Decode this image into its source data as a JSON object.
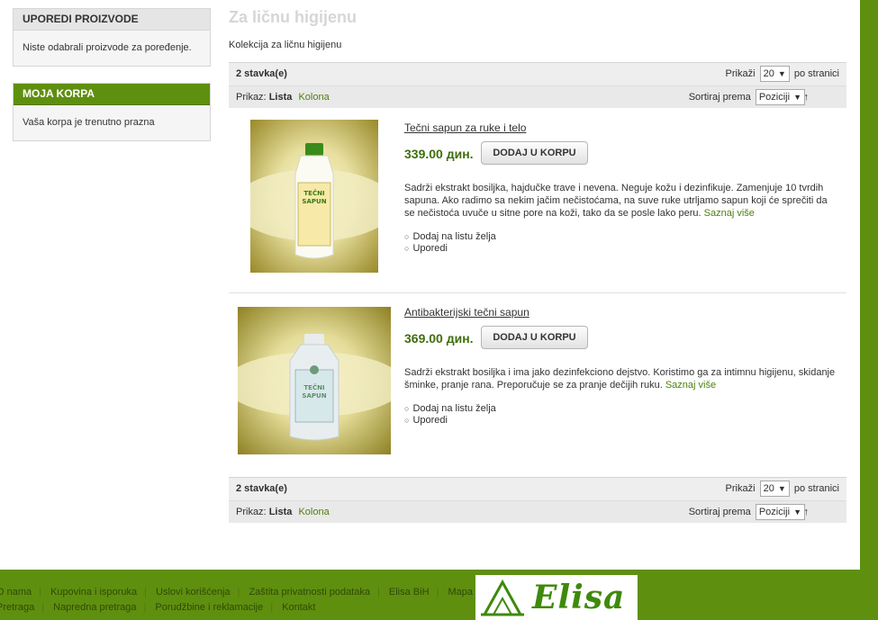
{
  "sidebar": {
    "compare": {
      "title": "UPOREDI PROIZVODE",
      "empty": "Niste odabrali proizvode za poređenje."
    },
    "cart": {
      "title": "MOJA KORPA",
      "empty": "Vaša korpa je trenutno prazna"
    }
  },
  "category": {
    "title": "Za ličnu higijenu",
    "description": "Kolekcija za ličnu higijenu"
  },
  "toolbar": {
    "count": "2 stavka(e)",
    "show_label": "Prikaži",
    "limit": "20",
    "per_page": "po stranici",
    "view_label": "Prikaz:",
    "view_list": "Lista",
    "view_grid": "Kolona",
    "sort_label": "Sortiraj prema",
    "sort_value": "Poziciji",
    "sort_dir_icon": "↑"
  },
  "products": [
    {
      "name": "Tečni sapun za ruke i telo",
      "price": "339.00 дин.",
      "button": "DODAJ U KORPU",
      "description": "Sadrži ekstrakt bosiljka, hajdučke trave i nevena. Neguje kožu i dezinfikuje. Zamenjuje 10 tvrdih sapuna. Ako radimo sa nekim jačim nečistoćama, na suve ruke utrljamo sapun koji će sprečiti da se nečistoća uvuče u sitne pore na koži, tako da se posle lako peru.",
      "more": "Saznaj više",
      "wishlist": "Dodaj na listu želja",
      "compare": "Uporedi",
      "bottle_label": "TEČNI SAPUN"
    },
    {
      "name": "Antibakterijski tečni sapun",
      "price": "369.00 дин.",
      "button": "DODAJ U KORPU",
      "description": "Sadrži ekstrakt bosiljka i ima jako dezinfekciono dejstvo. Koristimo ga za intimnu higijenu, skidanje šminke, pranje rana. Preporučuje se za pranje dečijih ruku.",
      "more": "Saznaj više",
      "wishlist": "Dodaj na listu želja",
      "compare": "Uporedi",
      "bottle_label": "TEČNI SAPUN"
    }
  ],
  "footer": {
    "row1": [
      "O nama",
      "Kupovina i isporuka",
      "Uslovi korišćenja",
      "Zaštita privatnosti podataka",
      "Elisa BiH",
      "Mapa sajta"
    ],
    "row2": [
      "Pretraga",
      "Napredna pretraga",
      "Porudžbine i reklamacije",
      "Kontakt"
    ],
    "logo": "Elisa"
  },
  "colors": {
    "brand_green": "#5f8f0f",
    "price_green": "#3e6e0c",
    "link_green": "#4f7f0d"
  }
}
